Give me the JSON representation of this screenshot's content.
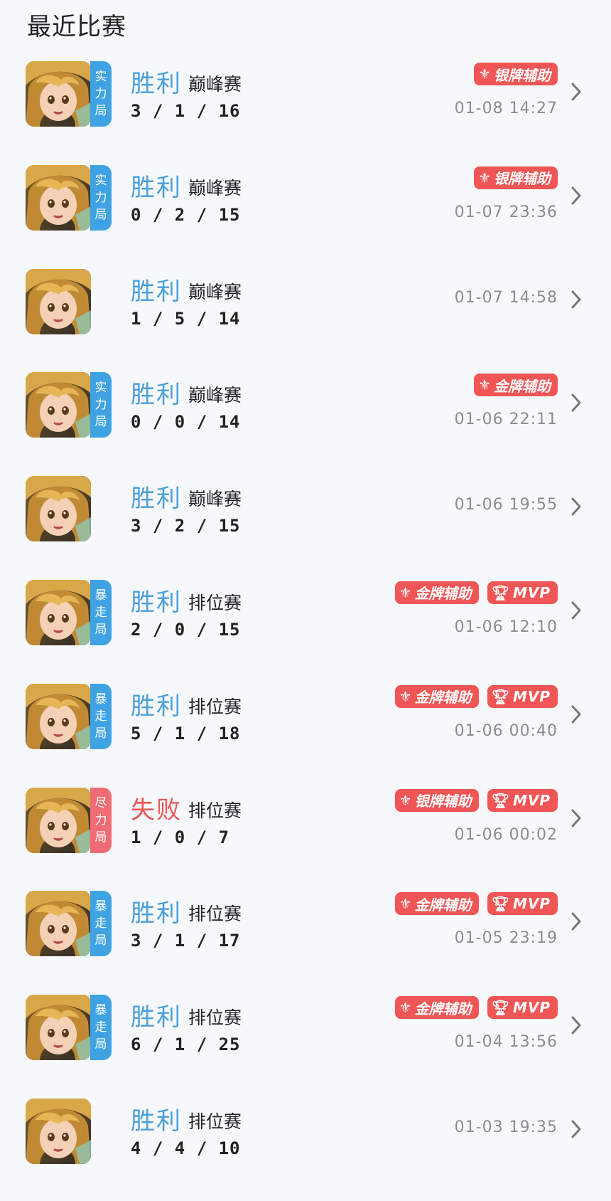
{
  "page": {
    "title": "最近比赛"
  },
  "colors": {
    "win": "#4a9fd8",
    "loss": "#ee5555",
    "badge": "#f15656",
    "tier_blue": "#3fa2e3",
    "tier_red": "#f06c74"
  },
  "matches": [
    {
      "result": "胜利",
      "result_type": "win",
      "mode": "巅峰赛",
      "kda": "3 / 1 / 16",
      "time": "01-08  14:27",
      "tier": [
        "实",
        "力",
        "局"
      ],
      "tier_color": "blue",
      "badges": [
        "银牌辅助"
      ],
      "mvp": null
    },
    {
      "result": "胜利",
      "result_type": "win",
      "mode": "巅峰赛",
      "kda": "0 / 2 / 15",
      "time": "01-07  23:36",
      "tier": [
        "实",
        "力",
        "局"
      ],
      "tier_color": "blue",
      "badges": [
        "银牌辅助"
      ],
      "mvp": null
    },
    {
      "result": "胜利",
      "result_type": "win",
      "mode": "巅峰赛",
      "kda": "1 / 5 / 14",
      "time": "01-07  14:58",
      "tier": null,
      "tier_color": null,
      "badges": [],
      "mvp": null
    },
    {
      "result": "胜利",
      "result_type": "win",
      "mode": "巅峰赛",
      "kda": "0 / 0 / 14",
      "time": "01-06  22:11",
      "tier": [
        "实",
        "力",
        "局"
      ],
      "tier_color": "blue",
      "badges": [
        "金牌辅助"
      ],
      "mvp": null
    },
    {
      "result": "胜利",
      "result_type": "win",
      "mode": "巅峰赛",
      "kda": "3 / 2 / 15",
      "time": "01-06  19:55",
      "tier": null,
      "tier_color": null,
      "badges": [],
      "mvp": null
    },
    {
      "result": "胜利",
      "result_type": "win",
      "mode": "排位赛",
      "kda": "2 / 0 / 15",
      "time": "01-06  12:10",
      "tier": [
        "暴",
        "走",
        "局"
      ],
      "tier_color": "blue",
      "badges": [
        "金牌辅助"
      ],
      "mvp": "MVP"
    },
    {
      "result": "胜利",
      "result_type": "win",
      "mode": "排位赛",
      "kda": "5 / 1 / 18",
      "time": "01-06  00:40",
      "tier": [
        "暴",
        "走",
        "局"
      ],
      "tier_color": "blue",
      "badges": [
        "金牌辅助"
      ],
      "mvp": "MVP"
    },
    {
      "result": "失败",
      "result_type": "loss",
      "mode": "排位赛",
      "kda": "1 / 0 / 7",
      "time": "01-06  00:02",
      "tier": [
        "尽",
        "力",
        "局"
      ],
      "tier_color": "red",
      "badges": [
        "银牌辅助"
      ],
      "mvp": "MVP"
    },
    {
      "result": "胜利",
      "result_type": "win",
      "mode": "排位赛",
      "kda": "3 / 1 / 17",
      "time": "01-05  23:19",
      "tier": [
        "暴",
        "走",
        "局"
      ],
      "tier_color": "blue",
      "badges": [
        "金牌辅助"
      ],
      "mvp": "MVP"
    },
    {
      "result": "胜利",
      "result_type": "win",
      "mode": "排位赛",
      "kda": "6 / 1 / 25",
      "time": "01-04  13:56",
      "tier": [
        "暴",
        "走",
        "局"
      ],
      "tier_color": "blue",
      "badges": [
        "金牌辅助"
      ],
      "mvp": "MVP"
    },
    {
      "result": "胜利",
      "result_type": "win",
      "mode": "排位赛",
      "kda": "4 / 4 / 10",
      "time": "01-03  19:35",
      "tier": null,
      "tier_color": null,
      "badges": [],
      "mvp": null
    }
  ]
}
